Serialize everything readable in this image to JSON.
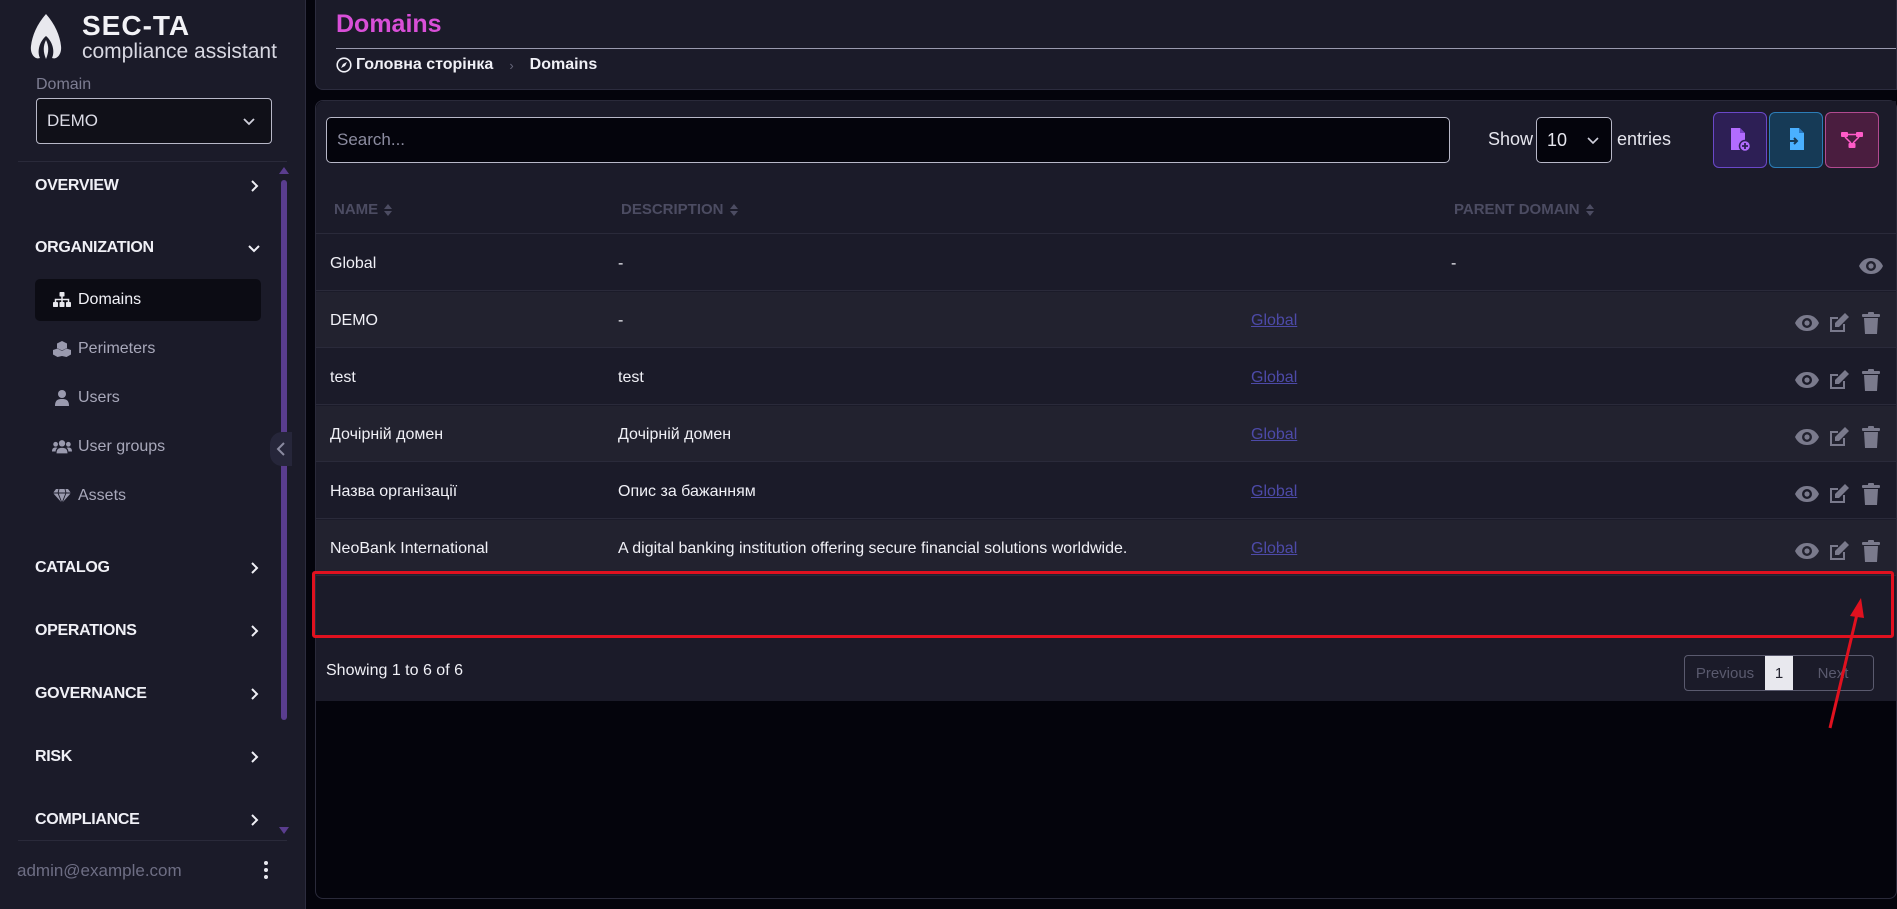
{
  "app": {
    "title": "SEC-TA",
    "subtitle": "compliance assistant"
  },
  "sidebar": {
    "domain_label": "Domain",
    "domain_value": "DEMO",
    "sections": [
      {
        "label": "OVERVIEW",
        "state": "collapsed"
      },
      {
        "label": "ORGANIZATION",
        "state": "expanded"
      },
      {
        "label": "CATALOG",
        "state": "collapsed"
      },
      {
        "label": "OPERATIONS",
        "state": "collapsed"
      },
      {
        "label": "GOVERNANCE",
        "state": "collapsed"
      },
      {
        "label": "RISK",
        "state": "collapsed"
      },
      {
        "label": "COMPLIANCE",
        "state": "collapsed"
      }
    ],
    "org_items": [
      {
        "label": "Domains",
        "icon": "sitemap-icon",
        "active": true
      },
      {
        "label": "Perimeters",
        "icon": "cubes-icon",
        "active": false
      },
      {
        "label": "Users",
        "icon": "user-icon",
        "active": false
      },
      {
        "label": "User groups",
        "icon": "users-icon",
        "active": false
      },
      {
        "label": "Assets",
        "icon": "gem-icon",
        "active": false
      }
    ],
    "user_email": "admin@example.com"
  },
  "header": {
    "title": "Domains",
    "breadcrumb": [
      "Головна сторінка",
      "Domains"
    ]
  },
  "toolbar": {
    "search_placeholder": "Search...",
    "show_label": "Show",
    "entries_value": "10",
    "entries_label": "entries"
  },
  "table": {
    "columns": [
      "NAME",
      "DESCRIPTION",
      "PARENT DOMAIN"
    ],
    "rows": [
      {
        "name": "Global",
        "description": "-",
        "parent": "-",
        "actions": [
          "view"
        ]
      },
      {
        "name": "DEMO",
        "description": "-",
        "parent": "Global",
        "actions": [
          "view",
          "edit",
          "delete"
        ]
      },
      {
        "name": "test",
        "description": "test",
        "parent": "Global",
        "actions": [
          "view",
          "edit",
          "delete"
        ]
      },
      {
        "name": "Дочірній домен",
        "description": "Дочірній домен",
        "parent": "Global",
        "actions": [
          "view",
          "edit",
          "delete"
        ]
      },
      {
        "name": "Назва організації",
        "description": "Опис за бажанням",
        "parent": "Global",
        "actions": [
          "view",
          "edit",
          "delete"
        ]
      },
      {
        "name": "NeoBank International",
        "description": "A digital banking institution offering secure financial solutions worldwide.",
        "parent": "Global",
        "actions": [
          "view",
          "edit",
          "delete"
        ]
      }
    ]
  },
  "footer": {
    "showing": "Showing 1 to 6 of 6",
    "prev": "Previous",
    "page": "1",
    "next": "Next"
  },
  "colors": {
    "accent": "#d94fd8",
    "highlight": "#e0111f",
    "sidebar_bg": "#1b1b29"
  }
}
